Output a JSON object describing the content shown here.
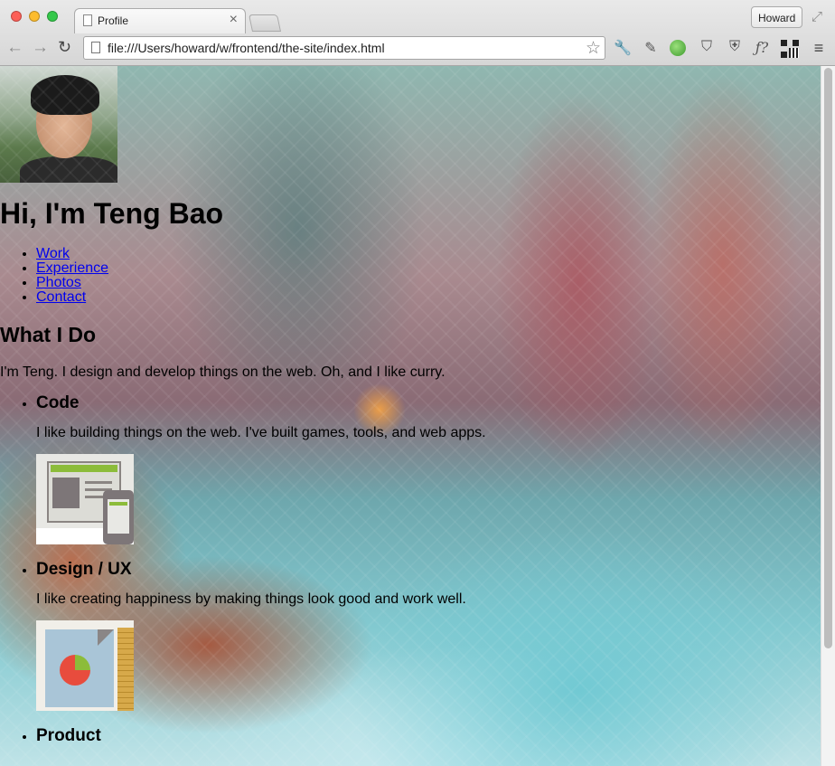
{
  "browser": {
    "tab_title": "Profile",
    "tab_close": "×",
    "profile_name": "Howard",
    "url": "file:///Users/howard/w/frontend/the-site/index.html",
    "nav": {
      "back": "←",
      "forward": "→",
      "reload": "↻"
    },
    "star": "☆",
    "extensions": [
      "wrench-icon",
      "evernote-icon",
      "globe-icon",
      "pocket-icon",
      "ublock-icon",
      "f?",
      "qr-code-icon",
      "menu-icon"
    ],
    "extension_glyphs": {
      "wrench": "🔧",
      "evernote": "✎",
      "pocket": "⛉",
      "ublock": "⛨",
      "formula": "ƒ?",
      "menu": "≡"
    },
    "resize": "⤢"
  },
  "page": {
    "heading": "Hi, I'm Teng Bao",
    "nav_links": [
      "Work",
      "Experience",
      "Photos",
      "Contact"
    ],
    "section_title": "What I Do",
    "intro": "I'm Teng. I design and develop things on the web. Oh, and I like curry.",
    "skills": [
      {
        "title": "Code",
        "desc": "I like building things on the web. I've built games, tools, and web apps."
      },
      {
        "title": "Design / UX",
        "desc": "I like creating happiness by making things look good and work well."
      },
      {
        "title": "Product"
      }
    ]
  },
  "colors": {
    "link": "#0000ee",
    "accent_green": "#8cbc3a",
    "pie_red": "#e84c3d"
  }
}
